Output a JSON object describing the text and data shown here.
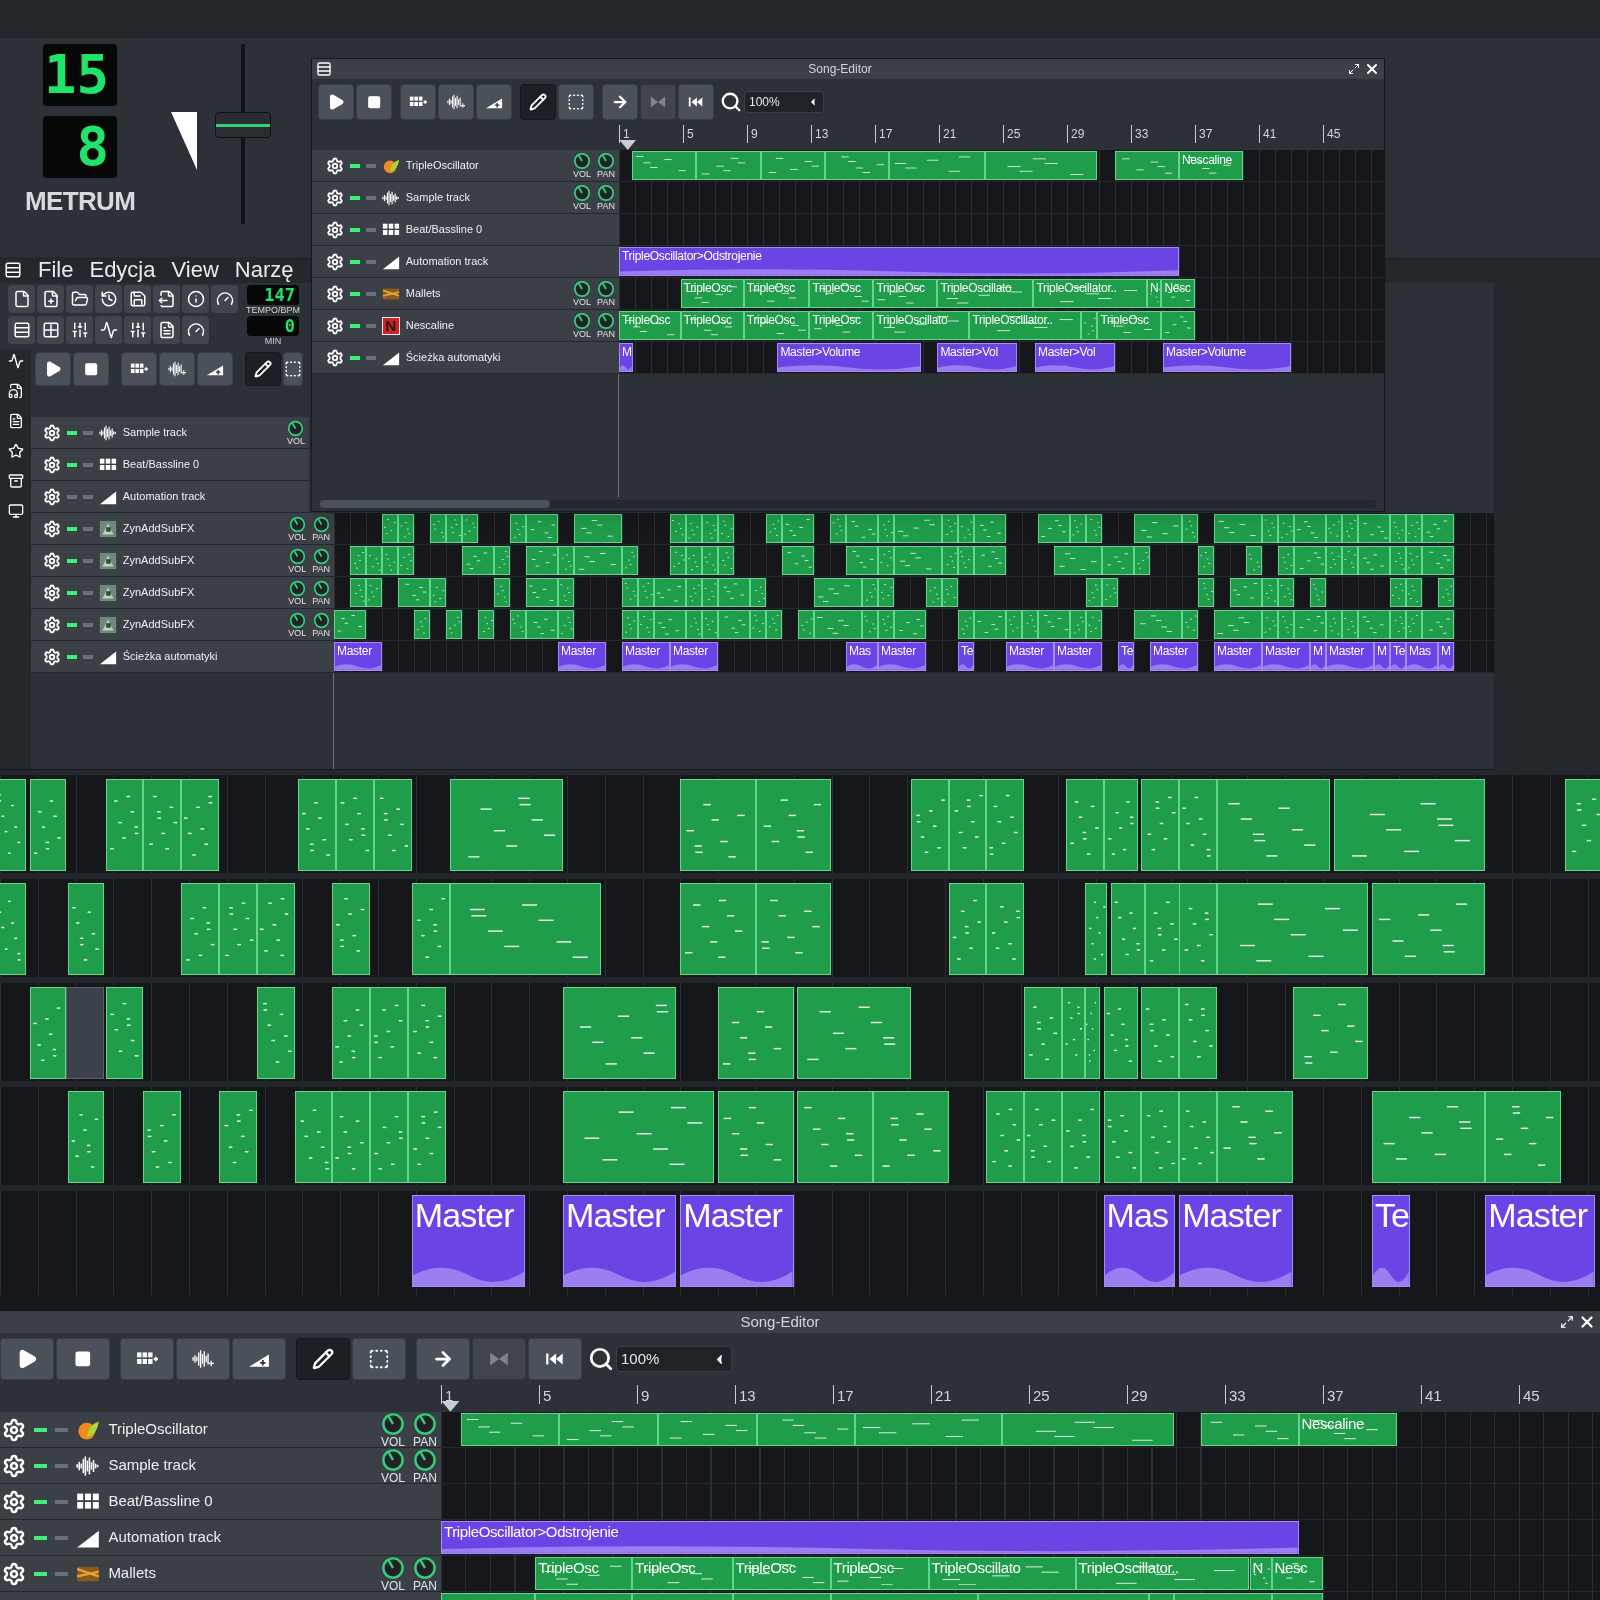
{
  "desktop": {
    "metrum": {
      "numerator": "15",
      "denominator": "8",
      "label": "METRUM"
    },
    "fader": {
      "level": 0.55
    }
  },
  "main_window": {
    "menu": [
      "File",
      "Edycja",
      "View",
      "Narzę"
    ],
    "tempo": {
      "value": "147",
      "label": "TEMPO/BPM"
    },
    "time": {
      "value": "0",
      "label": "MIN"
    },
    "song_toolbar": [
      {
        "kind": "play"
      },
      {
        "kind": "stop"
      },
      {
        "kind": "add_beat"
      },
      {
        "kind": "add_sample"
      },
      {
        "kind": "add_automation"
      },
      {
        "kind": "draw",
        "selected": true
      },
      {
        "kind": "select",
        "selected": false
      }
    ],
    "tracks": [
      {
        "kind": "sample",
        "name": "Sample track",
        "active": true,
        "knobs": [
          "VOL"
        ]
      },
      {
        "kind": "beat",
        "name": "Beat/Bassline 0",
        "active": true
      },
      {
        "kind": "automation",
        "name": "Automation track",
        "active": false
      },
      {
        "kind": "zyn",
        "name": "ZynAddSubFX",
        "active": true,
        "knobs": [
          "VOL",
          "PAN"
        ]
      },
      {
        "kind": "zyn",
        "name": "ZynAddSubFX",
        "active": true,
        "knobs": [
          "VOL",
          "PAN"
        ]
      },
      {
        "kind": "zyn",
        "name": "ZynAddSubFX",
        "active": true,
        "knobs": [
          "VOL",
          "PAN"
        ]
      },
      {
        "kind": "zyn",
        "name": "ZynAddSubFX",
        "active": true,
        "knobs": [
          "VOL",
          "PAN"
        ]
      },
      {
        "kind": "automation",
        "name": "Ścieżka automatyki",
        "active": true,
        "clips": [
          "Master",
          "Master",
          "Master",
          "Master",
          "Mas",
          "Master",
          "Te",
          "Master",
          "Master",
          "Te",
          "Master",
          "Master",
          "Master",
          "M",
          "Master",
          "M",
          "Te",
          "Mas",
          "M"
        ]
      }
    ]
  },
  "song_editor": {
    "title": "Song-Editor",
    "toolbar": [
      {
        "kind": "play"
      },
      {
        "kind": "stop"
      },
      {
        "kind": "add_beat"
      },
      {
        "kind": "add_sample"
      },
      {
        "kind": "add_automation"
      },
      {
        "kind": "draw",
        "selected": true
      },
      {
        "kind": "select",
        "selected": false
      },
      {
        "kind": "auto_scroll",
        "disabled": false
      },
      {
        "kind": "loop",
        "disabled": true
      },
      {
        "kind": "rewind"
      }
    ],
    "zoom": "100%",
    "ruler": [
      "1",
      "5",
      "9",
      "13",
      "17",
      "21",
      "25",
      "29",
      "33",
      "37",
      "41",
      "45"
    ],
    "tracks": [
      {
        "kind": "tripleosc",
        "name": "TripleOscillator",
        "active": true,
        "knobs": [
          "VOL",
          "PAN"
        ],
        "clips": [
          "Nescaline"
        ]
      },
      {
        "kind": "sample",
        "name": "Sample track",
        "active": true,
        "knobs": [
          "VOL",
          "PAN"
        ]
      },
      {
        "kind": "beat",
        "name": "Beat/Bassline 0",
        "active": true
      },
      {
        "kind": "automation",
        "name": "Automation track",
        "active": true,
        "clips": [
          "TripleOscillator>Odstrojenie"
        ]
      },
      {
        "kind": "mallets",
        "name": "Mallets",
        "active": true,
        "knobs": [
          "VOL",
          "PAN"
        ],
        "clips": [
          "TripleOsc",
          "TripleOsc",
          "TripleOsc",
          "TripleOsc",
          "TripleOscillato",
          "TripleOscillator..",
          "N",
          "Nesc"
        ]
      },
      {
        "kind": "nescaline",
        "icon_letter": "N",
        "name": "Nescaline",
        "active": true,
        "knobs": [
          "VOL",
          "PAN"
        ],
        "clips": [
          "TripleOsc",
          "TripleOsc",
          "TripleOsc",
          "TripleOsc",
          "TripleOscillato",
          "TripleOscillator..",
          "TripleOsc"
        ]
      },
      {
        "kind": "automation",
        "name": "Ścieżka automatyki",
        "active": true,
        "clips": [
          "M",
          "Master>Volume",
          "Master>Vol",
          "Master>Vol",
          "Master>Volume"
        ]
      }
    ]
  },
  "zoomed_view": {
    "automation_clips": [
      "Master",
      "Master",
      "Master",
      "Mas",
      "Master",
      "Te",
      "Master"
    ]
  },
  "bottom_song_editor": {
    "title": "Song-Editor",
    "toolbar": [
      {
        "kind": "play"
      },
      {
        "kind": "stop"
      },
      {
        "kind": "add_beat"
      },
      {
        "kind": "add_sample"
      },
      {
        "kind": "add_automation"
      },
      {
        "kind": "draw",
        "selected": true
      },
      {
        "kind": "select",
        "selected": false
      },
      {
        "kind": "auto_scroll",
        "disabled": false
      },
      {
        "kind": "loop",
        "disabled": true
      },
      {
        "kind": "rewind"
      }
    ],
    "zoom": "100%",
    "ruler": [
      "1",
      "5",
      "9",
      "13",
      "17",
      "21",
      "25",
      "29",
      "33",
      "37",
      "41",
      "45"
    ],
    "tracks": [
      {
        "kind": "tripleosc",
        "name": "TripleOscillator",
        "active": true,
        "knobs": [
          "VOL",
          "PAN"
        ],
        "clips": [
          "Nescaline"
        ]
      },
      {
        "kind": "sample",
        "name": "Sample track",
        "active": true,
        "knobs": [
          "VOL",
          "PAN"
        ]
      },
      {
        "kind": "beat",
        "name": "Beat/Bassline 0",
        "active": true
      },
      {
        "kind": "automation",
        "name": "Automation track",
        "active": true,
        "clips": [
          "TripleOscillator>Odstrojenie"
        ]
      },
      {
        "kind": "mallets",
        "name": "Mallets",
        "active": true,
        "knobs": [
          "VOL",
          "PAN"
        ],
        "clips": [
          "TripleOsc",
          "TripleOsc",
          "TripleOsc",
          "TripleOsc",
          "TripleOscillato",
          "TripleOscillator..",
          "N",
          "Nesc"
        ]
      }
    ]
  }
}
